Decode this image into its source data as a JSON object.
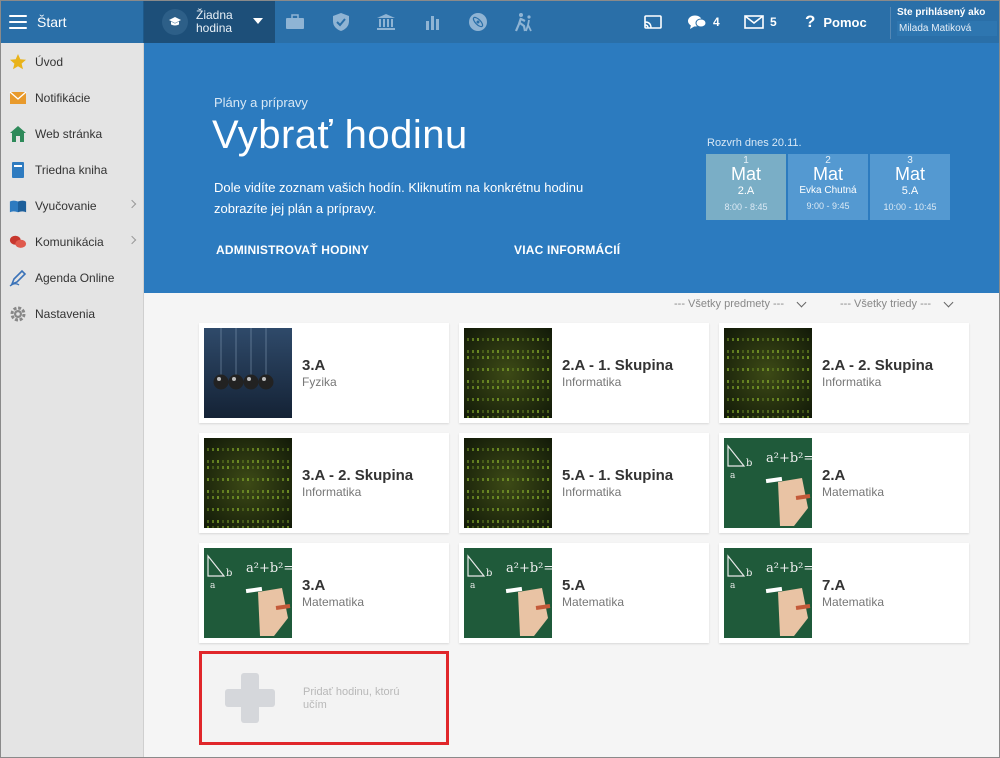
{
  "topbar": {
    "start_label": "Štart",
    "course_selector": {
      "line1": "Žiadna",
      "line2": "hodina"
    },
    "chat_count": "4",
    "mail_count": "5",
    "help_label": "Pomoc",
    "user_prefix": "Ste prihlásený ako",
    "user_name": "Milada Matiková"
  },
  "sidebar": {
    "items": [
      {
        "label": "Úvod",
        "icon": "star-icon"
      },
      {
        "label": "Notifikácie",
        "icon": "envelope-icon"
      },
      {
        "label": "Web stránka",
        "icon": "home-icon"
      },
      {
        "label": "Triedna kniha",
        "icon": "book-icon"
      },
      {
        "label": "Vyučovanie",
        "icon": "open-book-icon"
      },
      {
        "label": "Komunikácia",
        "icon": "chat-icon"
      },
      {
        "label": "Agenda Online",
        "icon": "pen-icon"
      },
      {
        "label": "Nastavenia",
        "icon": "gear-icon"
      }
    ]
  },
  "hero": {
    "subtitle": "Plány a prípravy",
    "title": "Vybrať hodinu",
    "description": "Dole vidíte zoznam vašich hodín. Kliknutím na konkrétnu hodinu zobrazíte jej plán a prípravy.",
    "link_admin": "ADMINISTROVAŤ HODINY",
    "link_more": "VIAC INFORMÁCIÍ"
  },
  "schedule": {
    "label": "Rozvrh dnes 20.11.",
    "slots": [
      {
        "num": "1",
        "subject": "Mat",
        "class": "2.A",
        "time": "8:00 - 8:45"
      },
      {
        "num": "2",
        "subject": "Mat",
        "class": "Evka Chutná",
        "time": "9:00 - 9:45"
      },
      {
        "num": "3",
        "subject": "Mat",
        "class": "5.A",
        "time": "10:00 - 10:45"
      }
    ]
  },
  "filters": {
    "subjects": "--- Všetky predmety ---",
    "classes": "--- Všetky triedy ---"
  },
  "cards": [
    {
      "title": "3.A",
      "subject": "Fyzika",
      "thumb": "cradle"
    },
    {
      "title": "2.A - 1. Skupina",
      "subject": "Informatika",
      "thumb": "matrix"
    },
    {
      "title": "2.A - 2. Skupina",
      "subject": "Informatika",
      "thumb": "matrix"
    },
    {
      "title": "3.A - 2. Skupina",
      "subject": "Informatika",
      "thumb": "matrix"
    },
    {
      "title": "5.A - 1. Skupina",
      "subject": "Informatika",
      "thumb": "matrix"
    },
    {
      "title": "2.A",
      "subject": "Matematika",
      "thumb": "chalk"
    },
    {
      "title": "3.A",
      "subject": "Matematika",
      "thumb": "chalk"
    },
    {
      "title": "5.A",
      "subject": "Matematika",
      "thumb": "chalk"
    },
    {
      "title": "7.A",
      "subject": "Matematika",
      "thumb": "chalk"
    }
  ],
  "add_card": {
    "label": "Pridať hodinu, ktorú učím"
  },
  "colors": {
    "topbar": "#2a6fa8",
    "hero": "#2c7bbf",
    "highlight": "#e0262a"
  }
}
